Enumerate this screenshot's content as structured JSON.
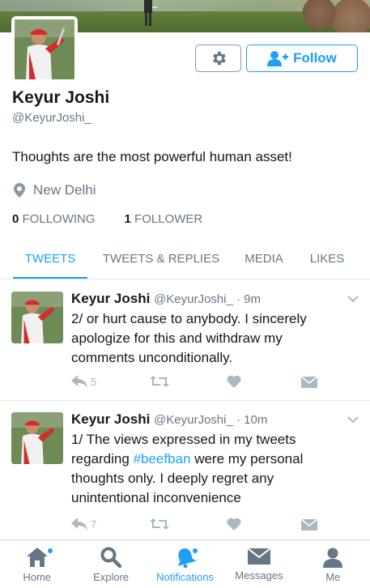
{
  "profile": {
    "name": "Keyur Joshi",
    "handle": "@KeyurJoshi_",
    "bio": "Thoughts are the most powerful human asset!",
    "location": "New Delhi",
    "following_count": "0",
    "following_label": "FOLLOWING",
    "followers_count": "1",
    "followers_label": "FOLLOWER",
    "follow_button": "Follow"
  },
  "tabs": [
    {
      "label": "TWEETS",
      "active": true
    },
    {
      "label": "TWEETS & REPLIES",
      "active": false
    },
    {
      "label": "MEDIA",
      "active": false
    },
    {
      "label": "LIKES",
      "active": false
    }
  ],
  "tweets": [
    {
      "name": "Keyur Joshi",
      "meta": "@KeyurJoshi_ · 9m",
      "text": "2/ or hurt cause to anybody. I sincerely apologize for this and withdraw my comments unconditionally.",
      "reply_count": "5"
    },
    {
      "name": "Keyur Joshi",
      "meta": "@KeyurJoshi_ · 10m",
      "text_before": "1/ The views expressed in my tweets regarding ",
      "hashtag": "#beefban",
      "text_after": " were my personal thoughts only. I deeply regret any unintentional inconvenience",
      "reply_count": "7"
    }
  ],
  "tabbar": [
    {
      "label": "Home",
      "icon": "home-icon",
      "active": false
    },
    {
      "label": "Explore",
      "icon": "search-icon",
      "active": false
    },
    {
      "label": "Notifications",
      "icon": "bell-icon",
      "active": true
    },
    {
      "label": "Messages",
      "icon": "envelope-icon",
      "active": false
    },
    {
      "label": "Me",
      "icon": "person-icon",
      "active": false
    }
  ],
  "colors": {
    "accent": "#1da1f2",
    "text": "#14171a",
    "muted": "#657786",
    "icon_muted": "#aab8c2"
  }
}
